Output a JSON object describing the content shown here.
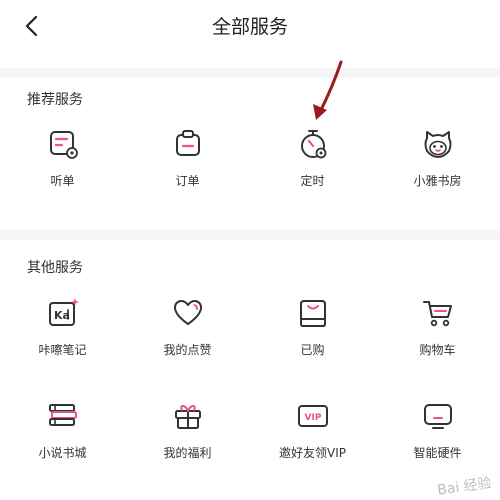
{
  "header": {
    "title": "全部服务"
  },
  "sections": [
    {
      "title": "推荐服务",
      "items": [
        {
          "label": "听单",
          "icon": "order-list-icon"
        },
        {
          "label": "订单",
          "icon": "clipboard-icon"
        },
        {
          "label": "定时",
          "icon": "timer-icon"
        },
        {
          "label": "小雅书房",
          "icon": "cat-avatar-icon"
        }
      ]
    },
    {
      "title": "其他服务",
      "items": [
        {
          "label": "咔嚓笔记",
          "icon": "kaji-note-icon"
        },
        {
          "label": "我的点赞",
          "icon": "heart-icon"
        },
        {
          "label": "已购",
          "icon": "purchased-icon"
        },
        {
          "label": "购物车",
          "icon": "cart-icon"
        },
        {
          "label": "小说书城",
          "icon": "books-icon"
        },
        {
          "label": "我的福利",
          "icon": "gift-icon"
        },
        {
          "label": "邀好友领VIP",
          "icon": "vip-icon"
        },
        {
          "label": "智能硬件",
          "icon": "device-icon"
        }
      ]
    }
  ],
  "icons": {
    "kaji_text": "Ka",
    "vip_text": "VIP"
  },
  "watermark": "Bai 经验",
  "colors": {
    "accent": "#f0547a",
    "icon_stroke": "#333333",
    "arrow": "#9b1b1f"
  }
}
